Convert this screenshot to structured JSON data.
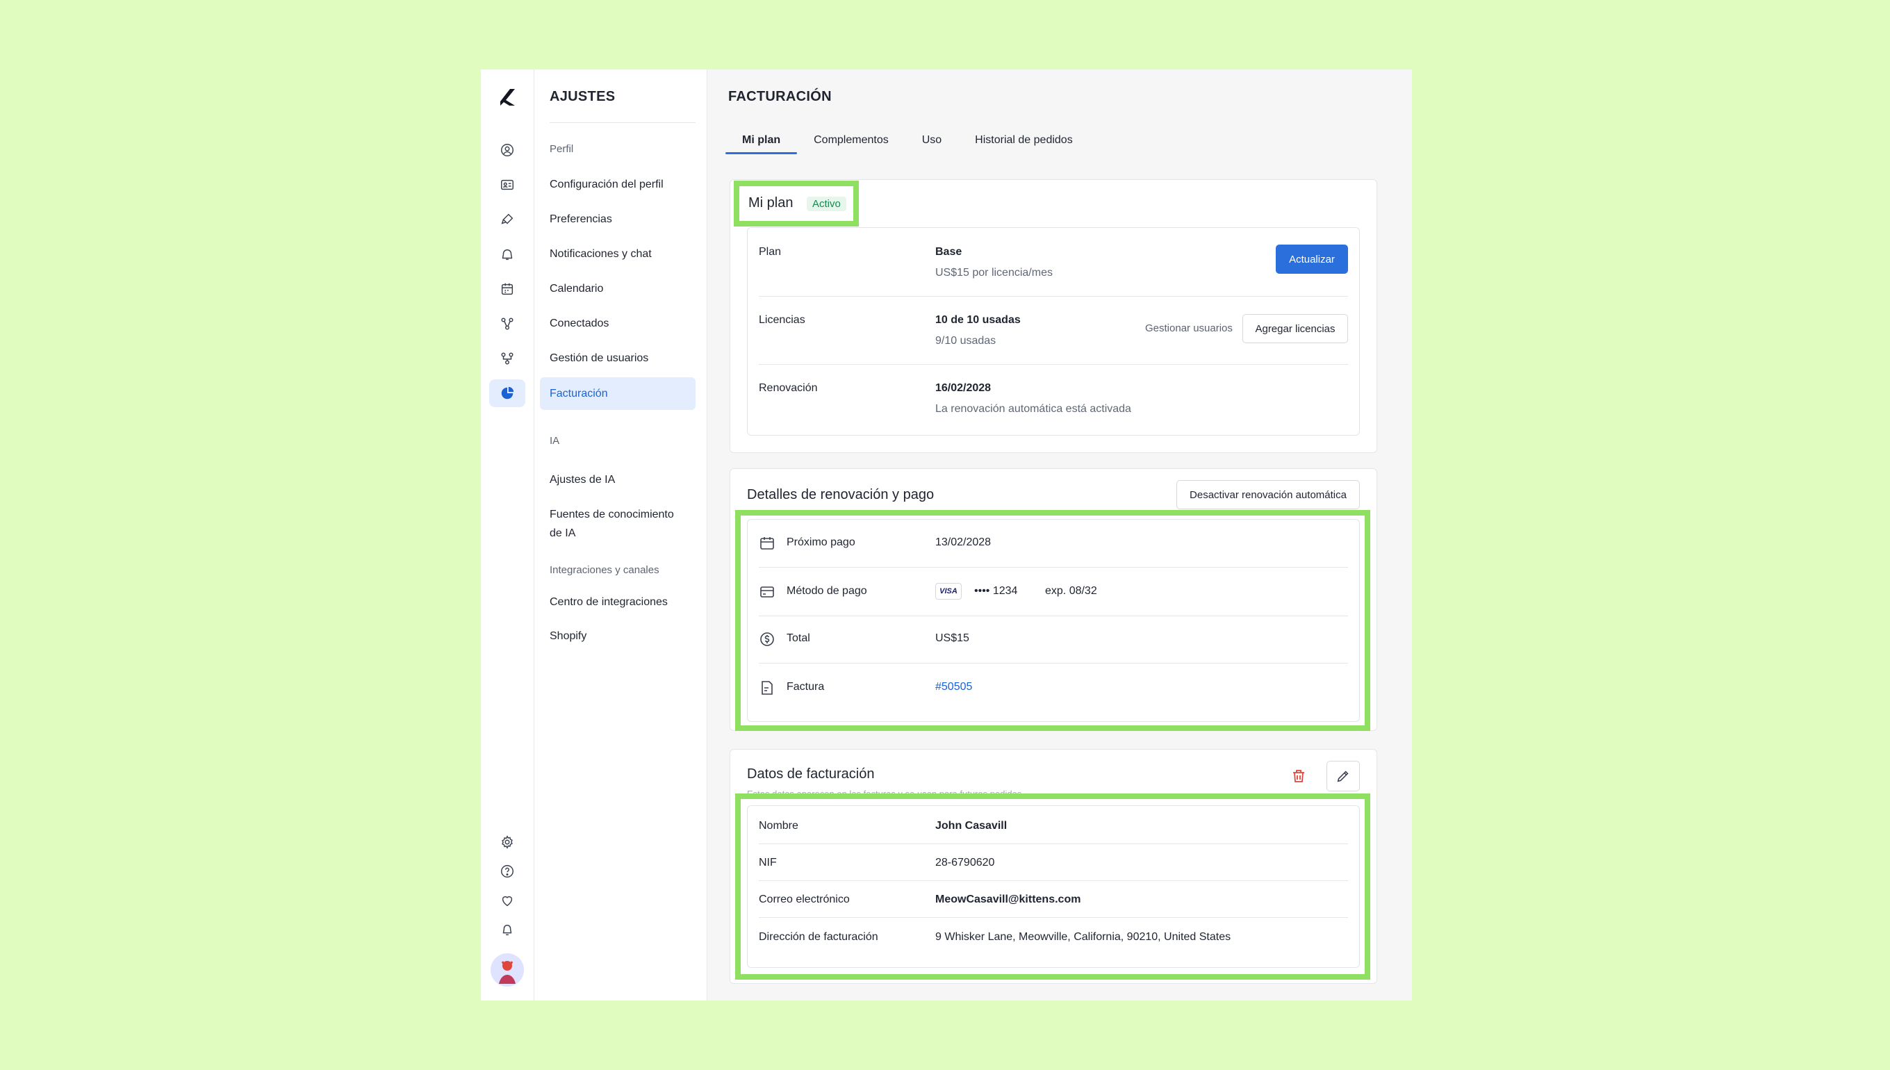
{
  "nav": {
    "title": "AJUSTES",
    "section_perfil": "Perfil",
    "items": [
      "Configuración del perfil",
      "Preferencias",
      "Notificaciones y chat",
      "Calendario",
      "Conectados",
      "Gestión de usuarios",
      "Facturación"
    ],
    "section_ia": "IA",
    "ia_items": [
      "Ajustes de IA",
      "Fuentes de conocimiento de IA"
    ],
    "section_integraciones": "Integraciones y canales",
    "integration_items": [
      "Centro de integraciones",
      "Shopify"
    ]
  },
  "page": {
    "title": "FACTURACIÓN"
  },
  "tabs": [
    "Mi plan",
    "Complementos",
    "Uso",
    "Historial de pedidos"
  ],
  "plan_card": {
    "title": "Mi plan",
    "badge": "Activo",
    "rows": {
      "plan": {
        "label": "Plan",
        "value": "Base",
        "sub": "US$15 por licencia/mes",
        "button": "Actualizar"
      },
      "licencias": {
        "label": "Licencias",
        "value": "10 de 10 usadas",
        "sub": "9/10 usadas",
        "manage_link": "Gestionar usuarios",
        "add_button": "Agregar licencias"
      },
      "renovacion": {
        "label": "Renovación",
        "value": "16/02/2028",
        "sub": "La renovación automática está activada"
      }
    }
  },
  "renewal_card": {
    "title": "Detalles de renovación y pago",
    "disable_button": "Desactivar renovación automática",
    "rows": {
      "next_payment": {
        "label": "Próximo pago",
        "value": "13/02/2028"
      },
      "method": {
        "label": "Método de pago",
        "card_brand": "VISA",
        "masked": "•••• 1234",
        "expiry": "exp. 08/32"
      },
      "total": {
        "label": "Total",
        "value": "US$15"
      },
      "invoice": {
        "label": "Factura",
        "value": "#50505"
      }
    }
  },
  "billing_card": {
    "title": "Datos de facturación",
    "subtitle": "Estos datos aparecen en las facturas y se usan para futuros pedidos",
    "rows": {
      "name": {
        "label": "Nombre",
        "value": "John Casavill"
      },
      "nif": {
        "label": "NIF",
        "value": "28-6790620"
      },
      "email": {
        "label": "Correo electrónico",
        "value": "MeowCasavill@kittens.com"
      },
      "address": {
        "label": "Dirección de facturación",
        "value": "9 Whisker Lane, Meowville, California, 90210, United States"
      }
    }
  },
  "colors": {
    "accent": "#2a6fdb",
    "highlight": "#8fe060",
    "background": "#e0fcbe",
    "delete": "#e0453a"
  }
}
